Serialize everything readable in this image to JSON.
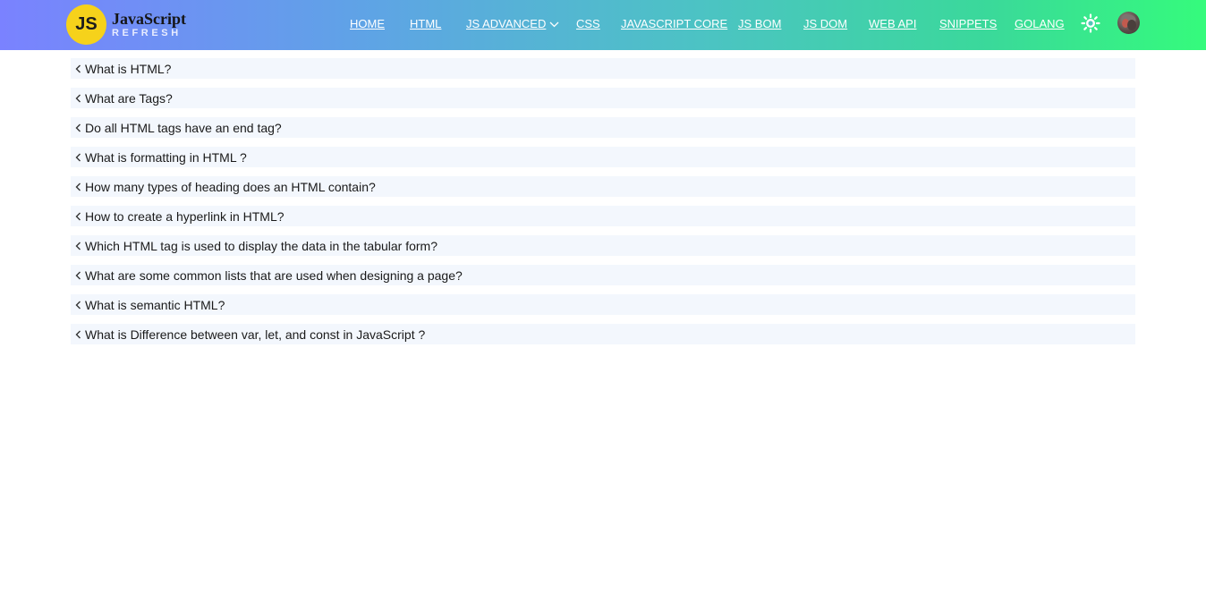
{
  "brand": {
    "badge": "JS",
    "title": "JavaScript",
    "subtitle": "REFRESH",
    "badge_color": "#f6d21b"
  },
  "nav": {
    "items": [
      {
        "label": "HOME"
      },
      {
        "label": "HTML"
      },
      {
        "label": "JS ADVANCED"
      },
      {
        "label": "CSS"
      },
      {
        "label": "JAVASCRIPT CORE"
      },
      {
        "label": "JS BOM"
      },
      {
        "label": "JS DOM"
      },
      {
        "label": "WEB API"
      },
      {
        "label": "SNIPPETS"
      },
      {
        "label": "GOLANG"
      }
    ],
    "theme_icon": "sun-icon",
    "avatar_icon": "user-avatar"
  },
  "faq": {
    "items": [
      {
        "question": "What is HTML?"
      },
      {
        "question": "What are Tags?"
      },
      {
        "question": "Do all HTML tags have an end tag?"
      },
      {
        "question": "What is formatting in HTML ?"
      },
      {
        "question": "How many types of heading does an HTML contain?"
      },
      {
        "question": "How to create a hyperlink in HTML?"
      },
      {
        "question": "Which HTML tag is used to display the data in the tabular form?"
      },
      {
        "question": "What are some common lists that are used when designing a page?"
      },
      {
        "question": "What is semantic HTML?"
      },
      {
        "question": "What is Difference between var, let, and const in JavaScript ?"
      }
    ],
    "item_background": "#f3f7fd"
  }
}
